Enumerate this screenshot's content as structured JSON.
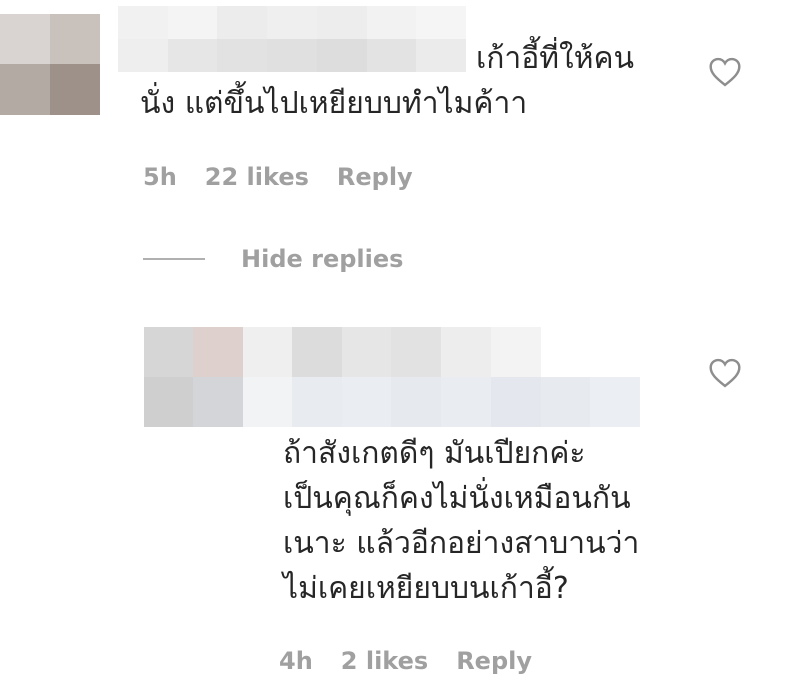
{
  "comments": [
    {
      "text_line1": "เก้าอี้ที่ให้คน",
      "text_line2": "นั่ง แต่ขึ้นไปเหยียบบทำไมค้าา",
      "time": "5h",
      "likes": "22 likes",
      "reply_label": "Reply"
    },
    {
      "text": "ถ้าสังเกตดีๆ มันเปียกค่ะ\nเป็นคุณก็คงไม่นั่งเหมือนกัน\nเนาะ แล้วอีกอย่างสาบานว่า\nไม่เคยเหยียบบนเก้าอี้?",
      "time": "4h",
      "likes": "2 likes",
      "reply_label": "Reply"
    }
  ],
  "replies_toggle": {
    "label": "Hide replies"
  },
  "icons": {
    "like": "heart-outline-icon"
  },
  "colors": {
    "text": "#262626",
    "meta": "#a0a0a0",
    "heart_stroke": "#8e8e8e"
  }
}
